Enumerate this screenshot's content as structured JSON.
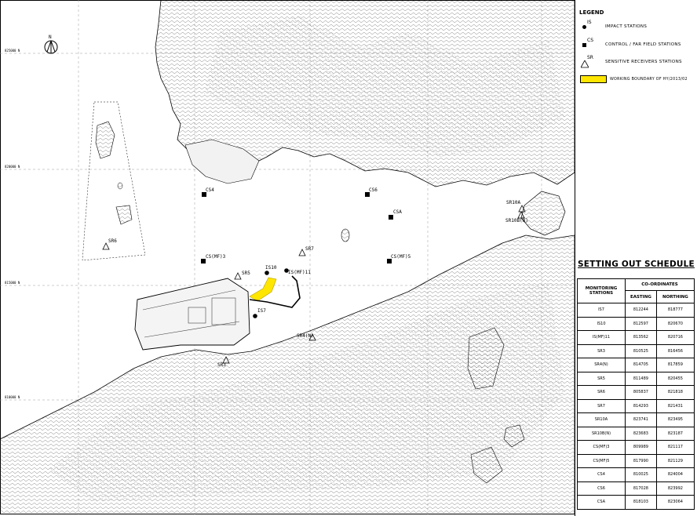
{
  "map": {
    "north_label": "N",
    "grid_labels_y": [
      "825000 N",
      "820000 N",
      "815000 N",
      "810000 N"
    ],
    "colors": {
      "land_fill": "#ffffff",
      "contour": "#555555",
      "working_boundary": "#ffe600"
    },
    "stations": [
      {
        "code": "CS4",
        "type": "control"
      },
      {
        "code": "CS6",
        "type": "control"
      },
      {
        "code": "CSA",
        "type": "control"
      },
      {
        "code": "CS(MF)3",
        "type": "control"
      },
      {
        "code": "CS(MF)5",
        "type": "control"
      },
      {
        "code": "IS10",
        "type": "impact"
      },
      {
        "code": "IS(MF)11",
        "type": "impact"
      },
      {
        "code": "IS7",
        "type": "impact"
      },
      {
        "code": "SR5",
        "type": "sensitive"
      },
      {
        "code": "SR6",
        "type": "sensitive"
      },
      {
        "code": "SR7",
        "type": "sensitive"
      },
      {
        "code": "SR3",
        "type": "sensitive"
      },
      {
        "code": "SR4(N)",
        "type": "sensitive"
      },
      {
        "code": "SR10A",
        "type": "sensitive"
      },
      {
        "code": "SR10B(N)",
        "type": "sensitive"
      }
    ]
  },
  "legend": {
    "title": "LEGEND",
    "items": [
      {
        "code": "IS",
        "icon": "impact-circle-icon",
        "text": "IMPACT STATIONS"
      },
      {
        "code": "CS",
        "icon": "control-square-icon",
        "text": "CONTROL / FAR FIELD STATIONS"
      },
      {
        "code": "SR",
        "icon": "receiver-triangle-icon",
        "text": "SENSITIVE RECEIVERS STATIONS"
      },
      {
        "code": "",
        "icon": "yellow-swatch",
        "text": "WORKING BOUNDARY OF HY/2013/02"
      }
    ]
  },
  "schedule": {
    "title": "SETTING OUT SCHEDULE",
    "col_station": "MONITORING STATIONS",
    "col_coords": "CO-ORDINATES",
    "col_easting": "EASTING",
    "col_northing": "NORTHING",
    "rows": [
      {
        "station": "IS7",
        "easting": "812244",
        "northing": "818777"
      },
      {
        "station": "IS10",
        "easting": "812597",
        "northing": "820670"
      },
      {
        "station": "IS(MF)11",
        "easting": "813562",
        "northing": "820716"
      },
      {
        "station": "SR3",
        "easting": "810525",
        "northing": "816456"
      },
      {
        "station": "SR4(N)",
        "easting": "814705",
        "northing": "817859"
      },
      {
        "station": "SR5",
        "easting": "811489",
        "northing": "820455"
      },
      {
        "station": "SR6",
        "easting": "805837",
        "northing": "821818"
      },
      {
        "station": "SR7",
        "easting": "814293",
        "northing": "821431"
      },
      {
        "station": "SR10A",
        "easting": "823741",
        "northing": "823495"
      },
      {
        "station": "SR10B(N)",
        "easting": "823683",
        "northing": "823187"
      },
      {
        "station": "CS(MF)3",
        "easting": "809989",
        "northing": "821117"
      },
      {
        "station": "CS(MF)5",
        "easting": "817990",
        "northing": "821129"
      },
      {
        "station": "CS4",
        "easting": "810025",
        "northing": "824004"
      },
      {
        "station": "CS6",
        "easting": "817028",
        "northing": "823992"
      },
      {
        "station": "CSA",
        "easting": "818103",
        "northing": "823064"
      }
    ]
  }
}
